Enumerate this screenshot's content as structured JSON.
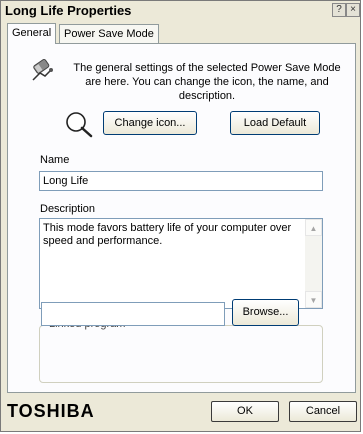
{
  "window": {
    "title": "Long Life Properties",
    "help_glyph": "?",
    "close_glyph": "×"
  },
  "tabs": [
    {
      "label": "General",
      "active": true
    },
    {
      "label": "Power Save Mode",
      "active": false
    }
  ],
  "general": {
    "intro_text": "The general settings of the selected Power Save Mode are here.  You can change the icon, the name, and description.",
    "change_icon_label": "Change icon...",
    "load_default_label": "Load Default",
    "name_label": "Name",
    "name_value": "Long Life",
    "description_label": "Description",
    "description_value": "This mode favors battery life of your computer over speed and performance.",
    "scroll_up_glyph": "▲",
    "scroll_down_glyph": "▼",
    "linked_program_label": "Linked program",
    "linked_program_value": "",
    "browse_label": "Browse..."
  },
  "footer": {
    "brand": "TOSHIBA",
    "ok_label": "OK",
    "cancel_label": "Cancel"
  },
  "icons": {
    "power_mode": "battery-plug-icon",
    "selected_icon": "magnifier-icon"
  },
  "colors": {
    "window_bg": "#ece9d8",
    "panel_bg": "#fcfcfe",
    "input_border": "#7f9db9"
  }
}
